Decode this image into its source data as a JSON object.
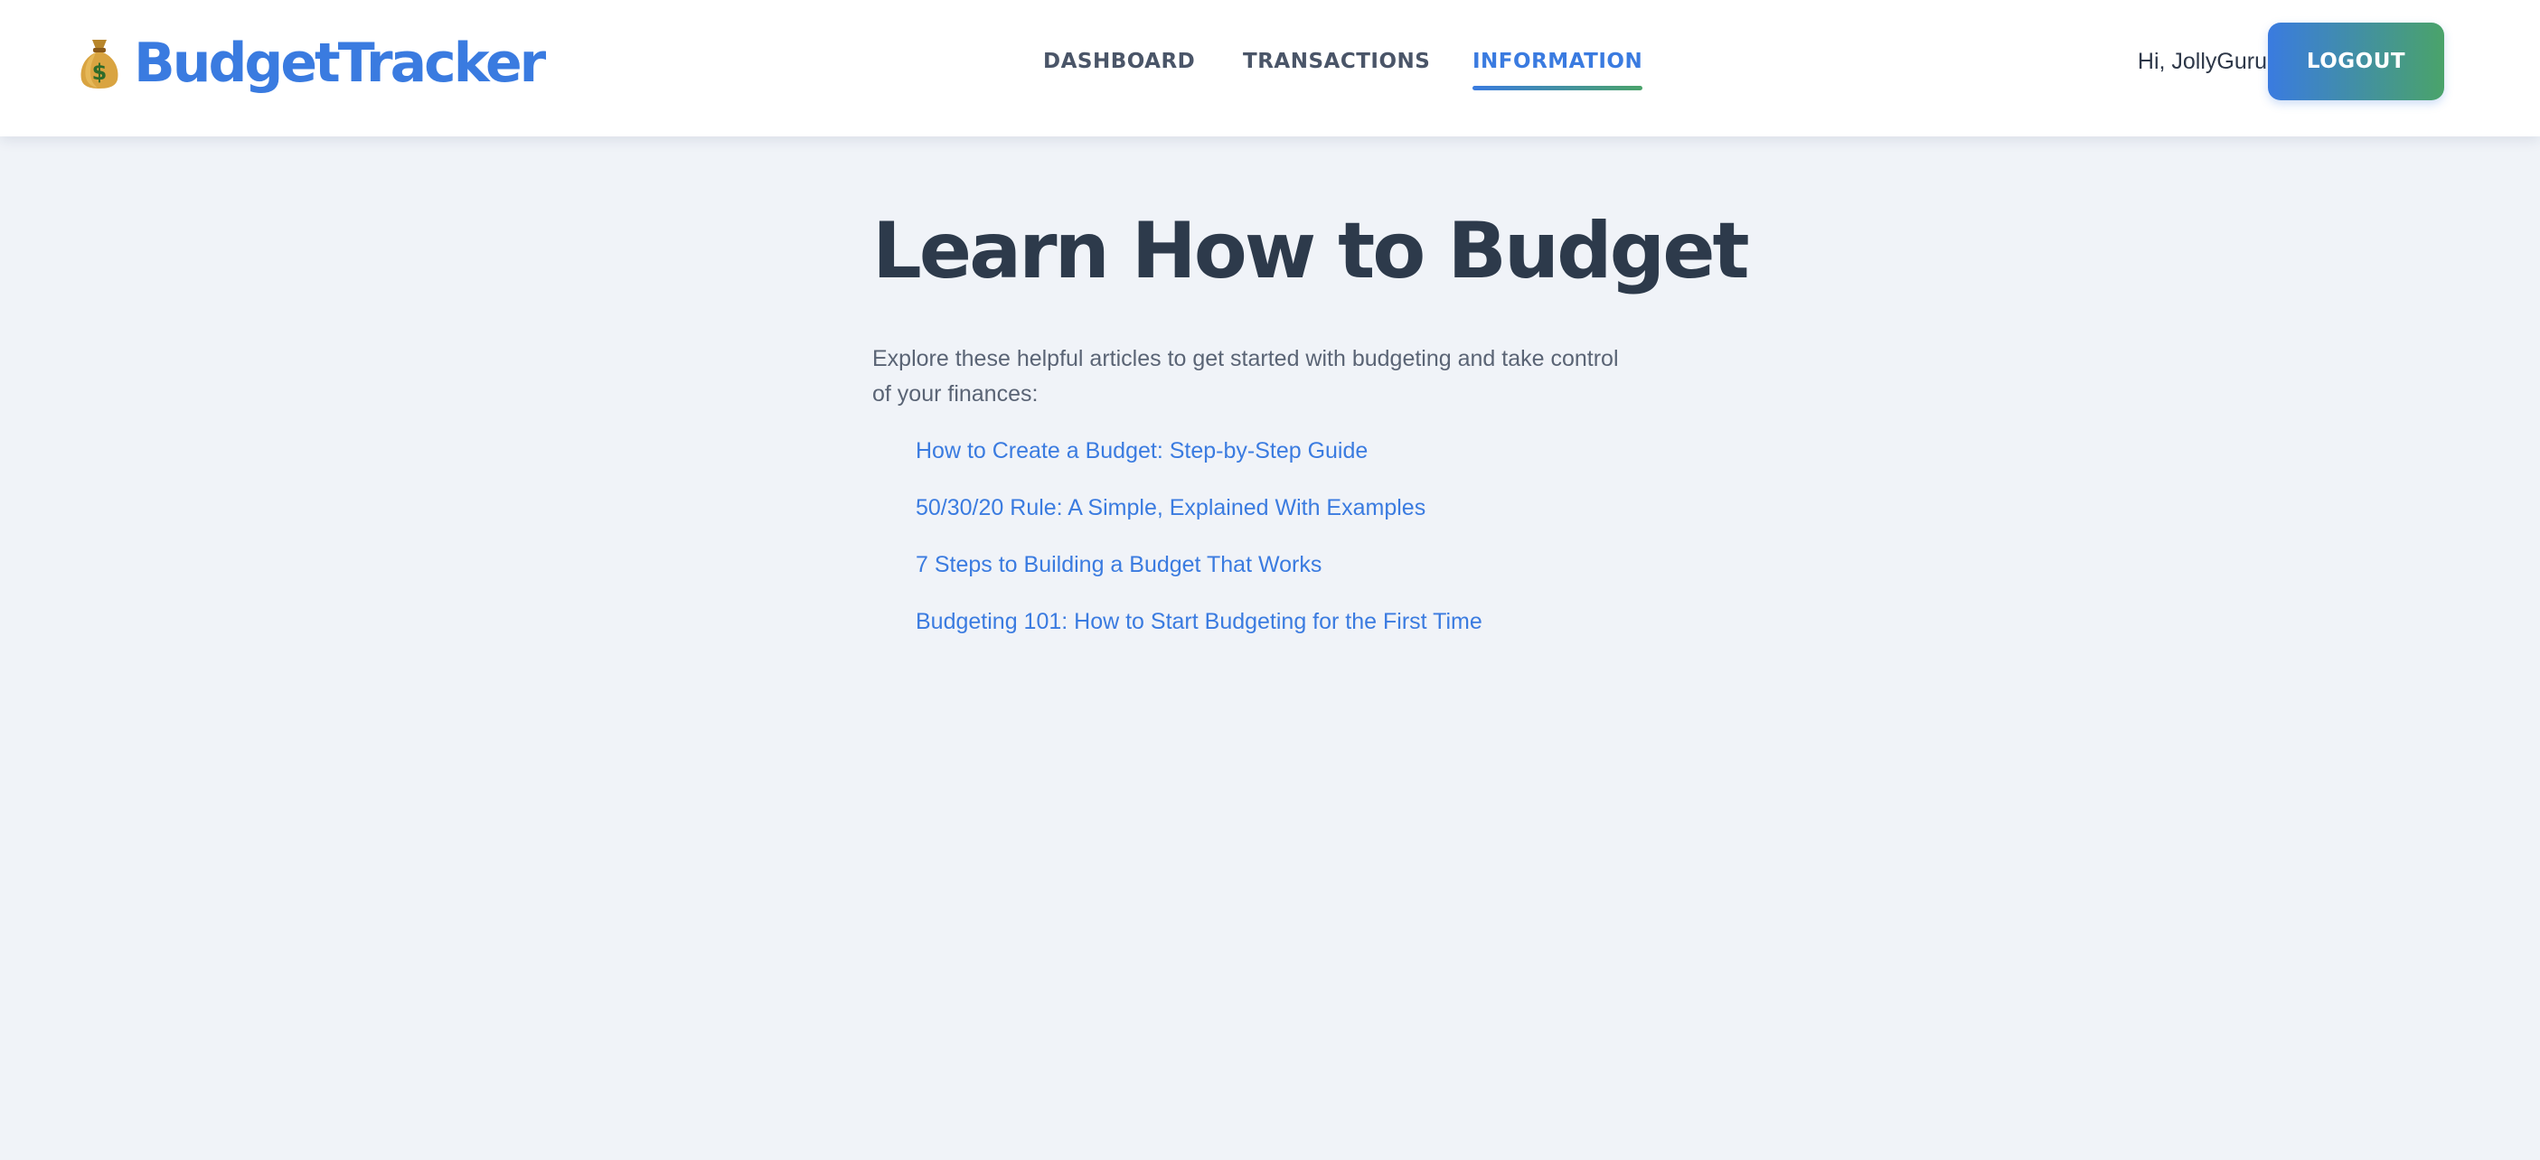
{
  "brand": {
    "name": "BudgetTracker",
    "icon": "money-bag-icon",
    "color": "#3a7be0"
  },
  "nav": {
    "items": [
      {
        "label": "DASHBOARD",
        "active": false
      },
      {
        "label": "TRANSACTIONS",
        "active": false
      },
      {
        "label": "INFORMATION",
        "active": true
      }
    ],
    "active_color": "#3a7be0"
  },
  "user": {
    "greeting": "Hi, JollyGuru",
    "logout_label": "LOGOUT"
  },
  "main": {
    "title": "Learn How to Budget",
    "intro": "Explore these helpful articles to get started with budgeting and take control of your finances:",
    "articles": [
      {
        "label": "How to Create a Budget: Step-by-Step Guide"
      },
      {
        "label": "50/30/20 Rule: A Simple, Explained With Examples"
      },
      {
        "label": "7 Steps to Building a Budget That Works"
      },
      {
        "label": "Budgeting 101: How to Start Budgeting for the First Time"
      }
    ]
  },
  "colors": {
    "accent_gradient_start": "#3a7be0",
    "accent_gradient_end": "#4aa36a",
    "background": "#f0f3f8"
  }
}
